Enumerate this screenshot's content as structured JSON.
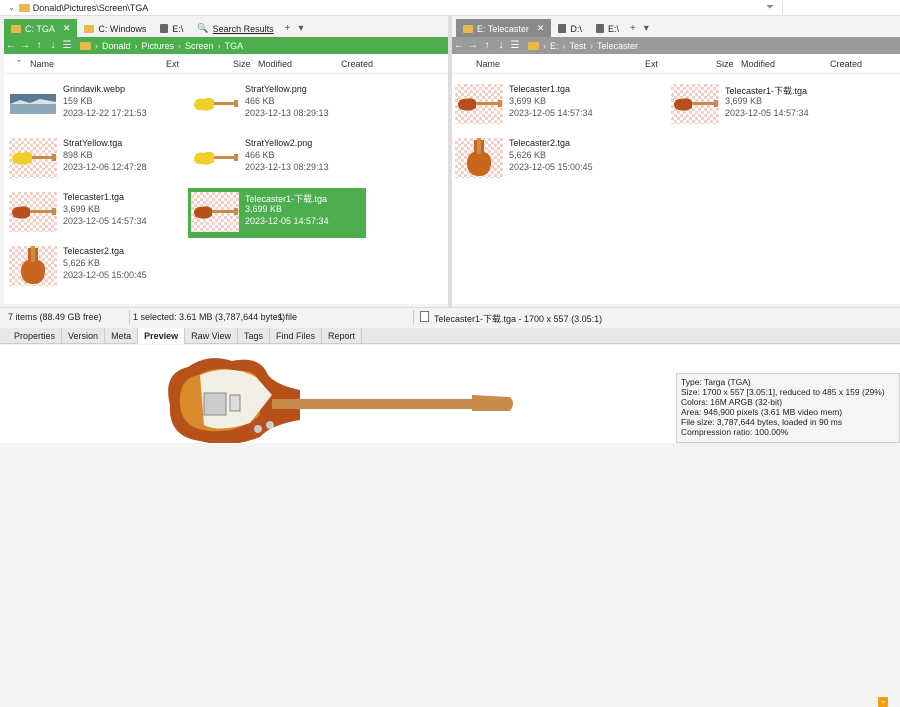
{
  "titlebar": {
    "path": "Donald\\Pictures\\Screen\\TGA"
  },
  "left": {
    "tabs": [
      {
        "label": "C: TGA"
      },
      {
        "label": "C: Windows"
      },
      {
        "label": "E:\\"
      },
      {
        "label": "Search Results"
      }
    ],
    "crumbs": [
      "Donald",
      "Pictures",
      "Screen",
      "TGA"
    ],
    "cols": {
      "name": "Name",
      "ext": "Ext",
      "size": "Size",
      "modified": "Modified",
      "created": "Created"
    },
    "items": [
      {
        "name": "Grindavik.webp",
        "size": "159 KB",
        "date": "2023-12-22 17:21:53",
        "thumb": "landscape"
      },
      {
        "name": "StratYellow.png",
        "size": "466 KB",
        "date": "2023-12-13 08:29:13",
        "thumb": "strat"
      },
      {
        "name": "StratYellow.tga",
        "size": "898 KB",
        "date": "2023-12-06 12:47:28",
        "thumb": "strat-check"
      },
      {
        "name": "StratYellow2.png",
        "size": "466 KB",
        "date": "2023-12-13 08:29:13",
        "thumb": "strat"
      },
      {
        "name": "Telecaster1.tga",
        "size": "3,699 KB",
        "date": "2023-12-05 14:57:34",
        "thumb": "tele"
      },
      {
        "name": "Telecaster1-下载.tga",
        "size": "3,699 KB",
        "date": "2023-12-05 14:57:34",
        "thumb": "tele",
        "selected": true
      },
      {
        "name": "Telecaster2.tga",
        "size": "5,626 KB",
        "date": "2023-12-05 15:00:45",
        "thumb": "tele-body"
      }
    ]
  },
  "right": {
    "tabs": [
      {
        "label": "E: Telecaster"
      },
      {
        "label": "D:\\"
      },
      {
        "label": "E:\\"
      }
    ],
    "crumbs": [
      "E:",
      "Test",
      "Telecaster"
    ],
    "cols": {
      "name": "Name",
      "ext": "Ext",
      "size": "Size",
      "modified": "Modified",
      "created": "Created"
    },
    "items": [
      {
        "name": "Telecaster1.tga",
        "size": "3,699 KB",
        "date": "2023-12-05 14:57:34",
        "thumb": "tele"
      },
      {
        "name": "Telecaster1-下载.tga",
        "size": "3,699 KB",
        "date": "2023-12-05 14:57:34",
        "thumb": "tele"
      },
      {
        "name": "Telecaster2.tga",
        "size": "5,626 KB",
        "date": "2023-12-05 15:00:45",
        "thumb": "tele-body"
      }
    ]
  },
  "status": {
    "items": "7 items (88.49 GB free)",
    "selected": "1 selected: 3.61 MB (3,787,644 bytes)",
    "files": "1 file",
    "preview": "Telecaster1-下载.tga - 1700 x 557 (3.05:1)"
  },
  "infotabs": [
    "Properties",
    "Version",
    "Meta",
    "Preview",
    "Raw View",
    "Tags",
    "Find Files",
    "Report"
  ],
  "info": {
    "lines": [
      "Type: Targa (TGA)",
      "Size: 1700 x 557 [3.05:1], reduced to 485 x 159 (29%)",
      "Colors: 16M ARGB (32-bit)",
      "Area: 946,900 pixels (3.61 MB video mem)",
      "File size: 3,787,644 bytes, loaded in 90 ms",
      "Compression ratio: 100.00%"
    ]
  },
  "colors": {
    "accent": "#4cae4c",
    "folder": "#e9b94a",
    "orange": "#f39c12"
  }
}
